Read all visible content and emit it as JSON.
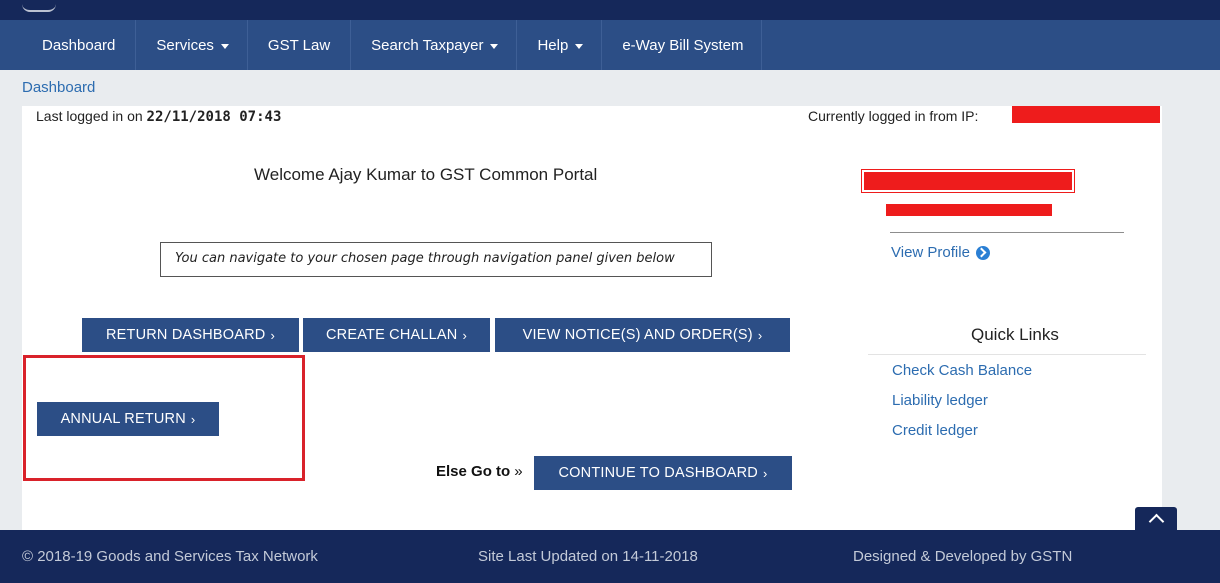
{
  "nav": {
    "items": [
      {
        "label": "Dashboard",
        "has_caret": false
      },
      {
        "label": "Services",
        "has_caret": true
      },
      {
        "label": "GST Law",
        "has_caret": false
      },
      {
        "label": "Search Taxpayer",
        "has_caret": true
      },
      {
        "label": "Help",
        "has_caret": true
      },
      {
        "label": "e-Way Bill System",
        "has_caret": false
      }
    ]
  },
  "breadcrumb": "Dashboard",
  "session": {
    "last_login_label": "Last logged in on",
    "last_login_value": "22/11/2018 07:43",
    "ip_label": "Currently logged in from IP:"
  },
  "welcome": "Welcome Ajay Kumar to GST Common Portal",
  "nav_hint": "You can navigate to your chosen page through navigation panel given below",
  "buttons": {
    "return_dashboard": "RETURN DASHBOARD",
    "create_challan": "CREATE CHALLAN",
    "view_notices": "VIEW NOTICE(S) AND ORDER(S)",
    "annual_return": "ANNUAL RETURN",
    "continue_dashboard": "CONTINUE TO DASHBOARD",
    "chevron": "›"
  },
  "else_go": "Else Go to",
  "else_go_symbol": "»",
  "profile": {
    "view_profile": "View Profile"
  },
  "quick_links": {
    "title": "Quick Links",
    "items": [
      "Check Cash Balance",
      "Liability ledger",
      "Credit ledger"
    ]
  },
  "footer": {
    "copyright": "© 2018-19 Goods and Services Tax Network",
    "updated": "Site Last Updated on 14-11-2018",
    "designed": "Designed & Developed by GSTN"
  },
  "colors": {
    "nav_bg": "#2c4e86",
    "header_dark": "#15285a",
    "link": "#2c6cb0",
    "highlight": "#d9222a",
    "redaction": "#ee1c1c"
  }
}
